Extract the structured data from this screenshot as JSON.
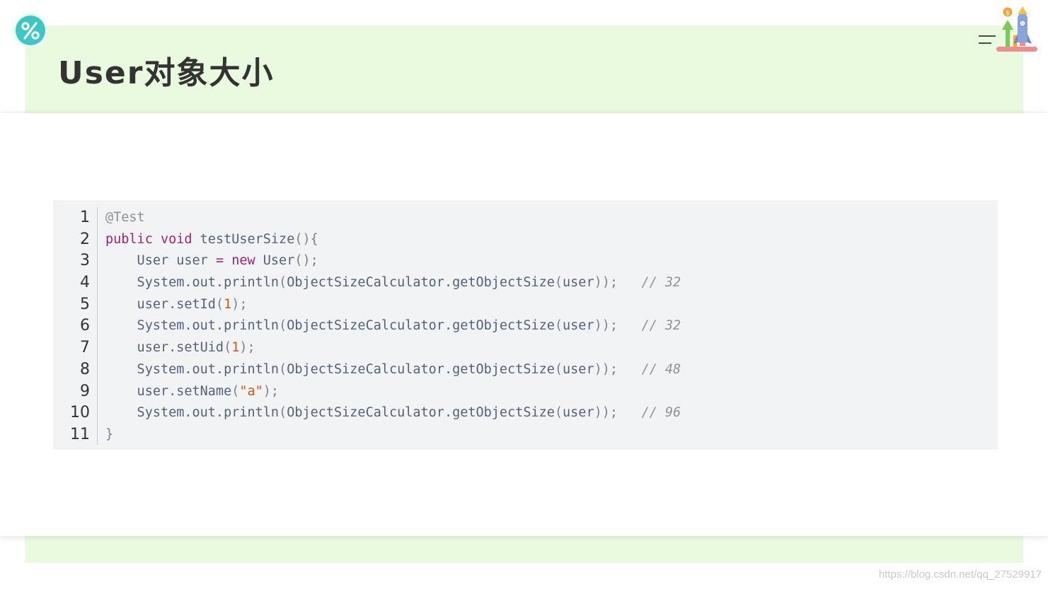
{
  "slide": {
    "title": "User对象大小",
    "watermark": "https://blog.csdn.net/qq_27529917",
    "colors": {
      "band": "#eafade",
      "badge": "#3cc7c4",
      "title": "#333333",
      "code_background": "#f2f3f5"
    },
    "icons": [
      "percent-icon",
      "menu-icon",
      "rocket-growth-icon"
    ]
  },
  "code": {
    "line_numbers": [
      "1",
      "2",
      "3",
      "4",
      "5",
      "6",
      "7",
      "8",
      "9",
      "10",
      "11"
    ],
    "lines": [
      [
        {
          "t": "annotation",
          "v": "@Test"
        }
      ],
      [
        {
          "t": "keyword",
          "v": "public"
        },
        {
          "t": "plain",
          "v": " "
        },
        {
          "t": "keyword",
          "v": "void"
        },
        {
          "t": "plain",
          "v": " "
        },
        {
          "t": "method",
          "v": "testUserSize"
        },
        {
          "t": "punct",
          "v": "(){"
        }
      ],
      [
        {
          "t": "plain",
          "v": "    User user "
        },
        {
          "t": "operator",
          "v": "="
        },
        {
          "t": "plain",
          "v": " "
        },
        {
          "t": "keyword",
          "v": "new"
        },
        {
          "t": "plain",
          "v": " User"
        },
        {
          "t": "punct",
          "v": "();"
        }
      ],
      [
        {
          "t": "plain",
          "v": "    System.out.println"
        },
        {
          "t": "punct",
          "v": "("
        },
        {
          "t": "plain",
          "v": "ObjectSizeCalculator.getObjectSize"
        },
        {
          "t": "punct",
          "v": "("
        },
        {
          "t": "plain",
          "v": "user"
        },
        {
          "t": "punct",
          "v": "));"
        },
        {
          "t": "plain",
          "v": "   "
        },
        {
          "t": "comment",
          "v": "// 32"
        }
      ],
      [
        {
          "t": "plain",
          "v": "    user.setId"
        },
        {
          "t": "punct",
          "v": "("
        },
        {
          "t": "number",
          "v": "1"
        },
        {
          "t": "punct",
          "v": ");"
        }
      ],
      [
        {
          "t": "plain",
          "v": "    System.out.println"
        },
        {
          "t": "punct",
          "v": "("
        },
        {
          "t": "plain",
          "v": "ObjectSizeCalculator.getObjectSize"
        },
        {
          "t": "punct",
          "v": "("
        },
        {
          "t": "plain",
          "v": "user"
        },
        {
          "t": "punct",
          "v": "));"
        },
        {
          "t": "plain",
          "v": "   "
        },
        {
          "t": "comment",
          "v": "// 32"
        }
      ],
      [
        {
          "t": "plain",
          "v": "    user.setUid"
        },
        {
          "t": "punct",
          "v": "("
        },
        {
          "t": "number",
          "v": "1"
        },
        {
          "t": "punct",
          "v": ");"
        }
      ],
      [
        {
          "t": "plain",
          "v": "    System.out.println"
        },
        {
          "t": "punct",
          "v": "("
        },
        {
          "t": "plain",
          "v": "ObjectSizeCalculator.getObjectSize"
        },
        {
          "t": "punct",
          "v": "("
        },
        {
          "t": "plain",
          "v": "user"
        },
        {
          "t": "punct",
          "v": "));"
        },
        {
          "t": "plain",
          "v": "   "
        },
        {
          "t": "comment",
          "v": "// 48"
        }
      ],
      [
        {
          "t": "plain",
          "v": "    user.setName"
        },
        {
          "t": "punct",
          "v": "("
        },
        {
          "t": "string",
          "v": "\"a\""
        },
        {
          "t": "punct",
          "v": ");"
        }
      ],
      [
        {
          "t": "plain",
          "v": "    System.out.println"
        },
        {
          "t": "punct",
          "v": "("
        },
        {
          "t": "plain",
          "v": "ObjectSizeCalculator.getObjectSize"
        },
        {
          "t": "punct",
          "v": "("
        },
        {
          "t": "plain",
          "v": "user"
        },
        {
          "t": "punct",
          "v": "));"
        },
        {
          "t": "plain",
          "v": "   "
        },
        {
          "t": "comment",
          "v": "// 96"
        }
      ],
      [
        {
          "t": "punct",
          "v": "}"
        }
      ]
    ]
  }
}
